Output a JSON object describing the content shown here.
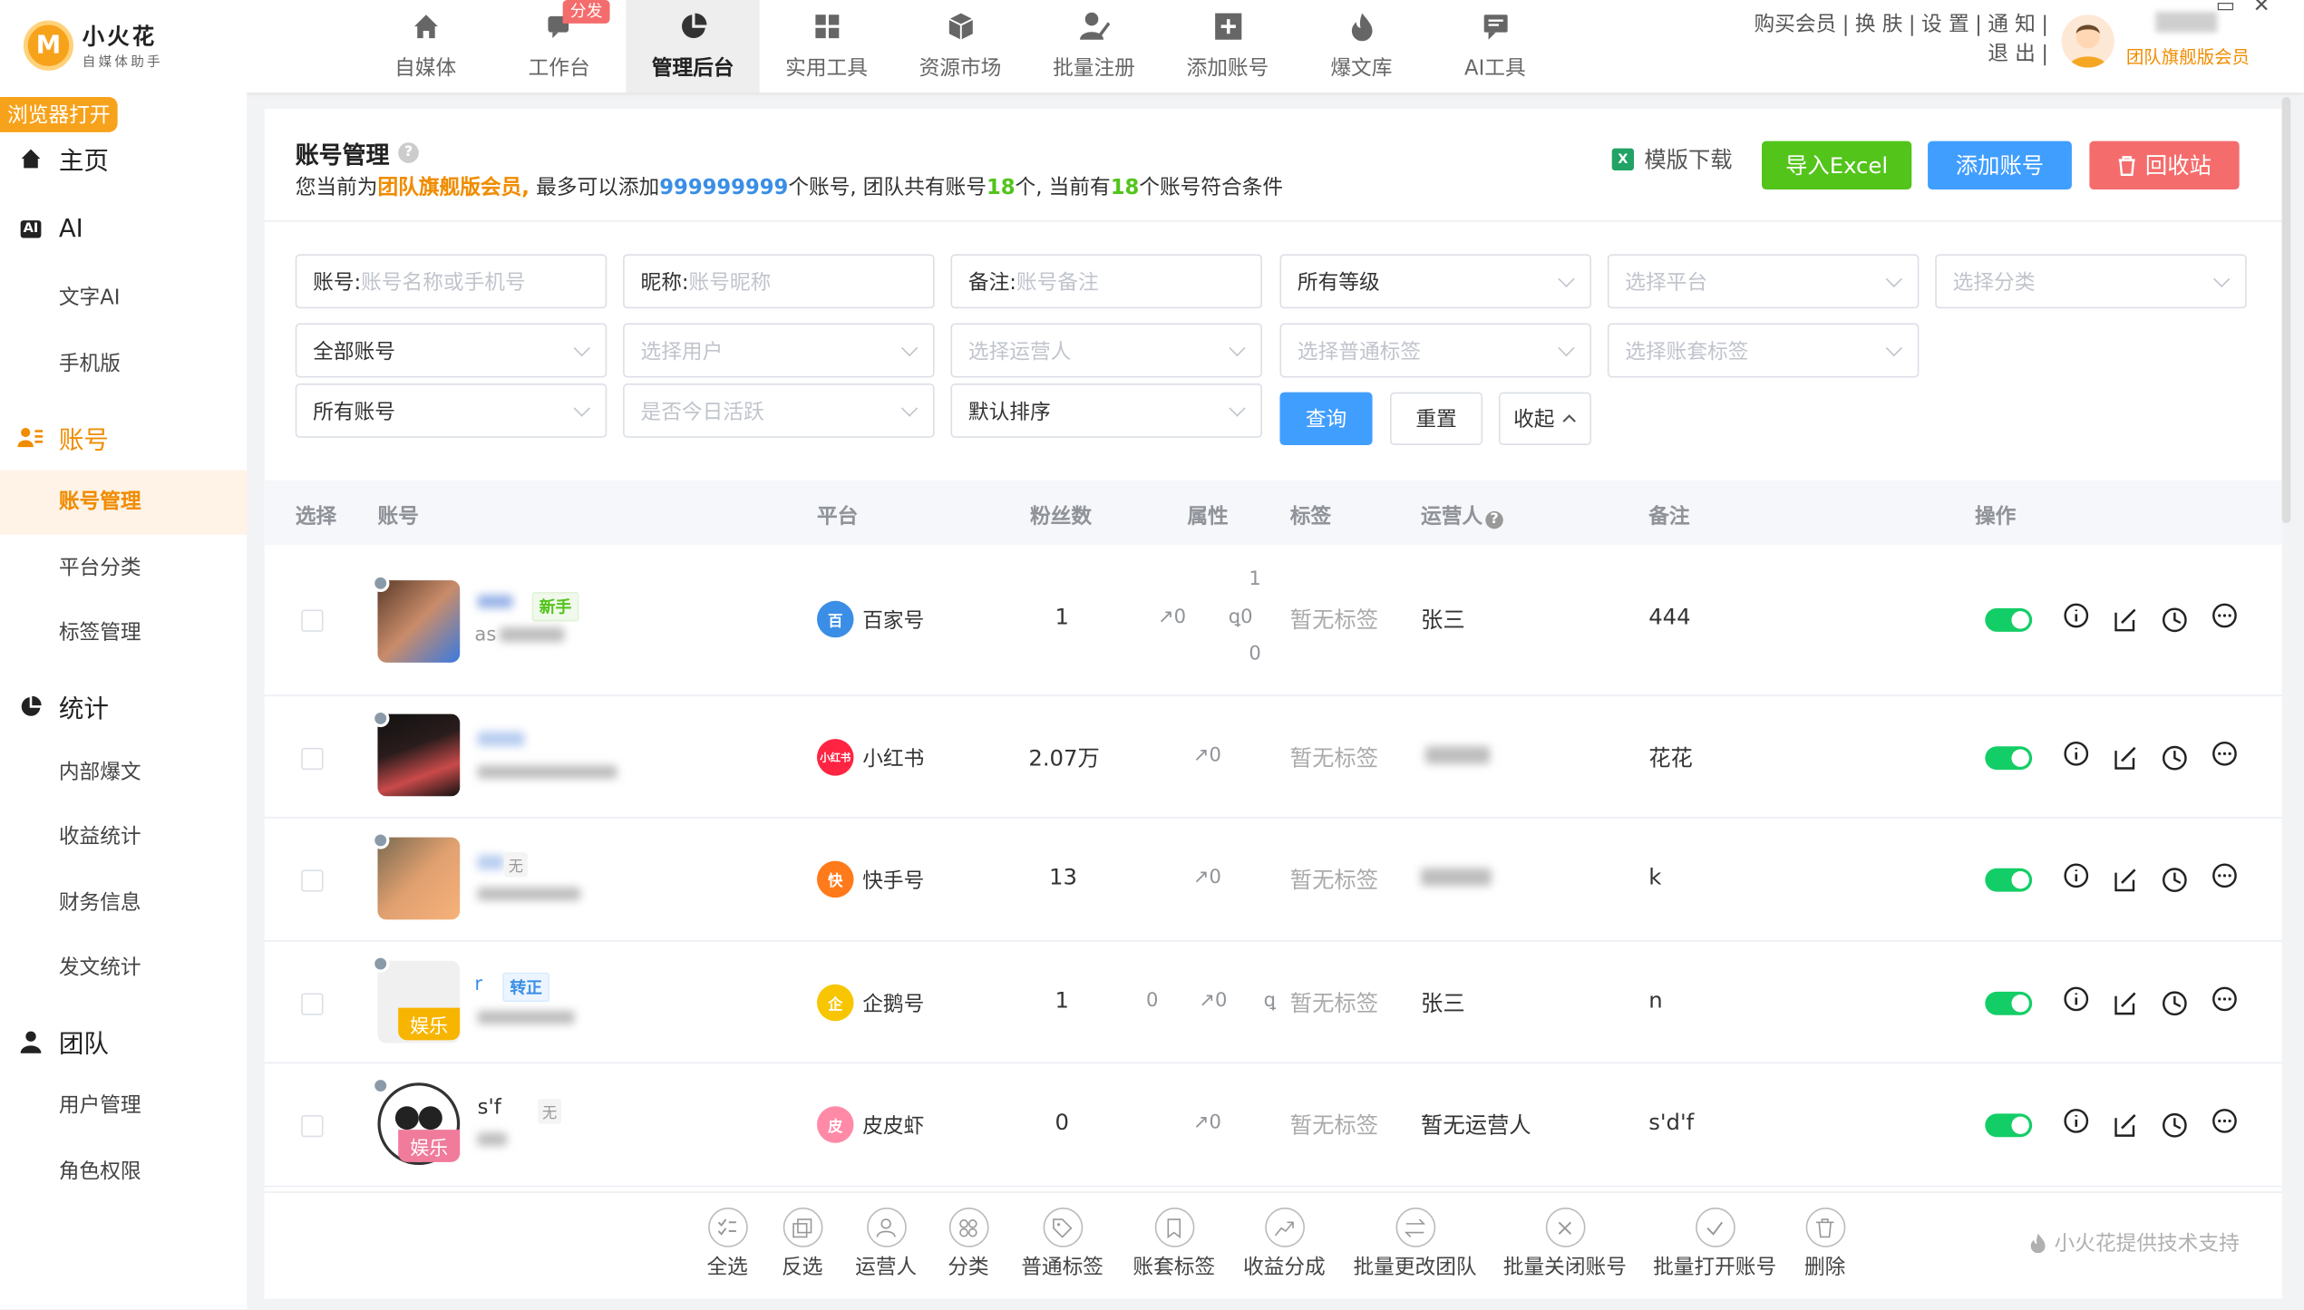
{
  "app": {
    "logo_letter": "M",
    "name": "小火花",
    "subtitle": "自媒体助手",
    "browser_tag": "浏览器打开"
  },
  "nav": [
    {
      "label": "自媒体",
      "icon": "home-icon"
    },
    {
      "label": "工作台",
      "icon": "chat-icon",
      "badge": "分发"
    },
    {
      "label": "管理后台",
      "icon": "pie-chart-icon",
      "active": true
    },
    {
      "label": "实用工具",
      "icon": "grid-icon"
    },
    {
      "label": "资源市场",
      "icon": "cube-icon"
    },
    {
      "label": "批量注册",
      "icon": "user-edit-icon"
    },
    {
      "label": "添加账号",
      "icon": "plus-square-icon"
    },
    {
      "label": "爆文库",
      "icon": "fire-icon"
    },
    {
      "label": "AI工具",
      "icon": "message-icon"
    }
  ],
  "toplinks": {
    "buy": "购买会员",
    "skin": "换 肤",
    "settings": "设 置",
    "notify": "通 知",
    "logout": "退 出",
    "sep": "|"
  },
  "member_label": "团队旗舰版会员",
  "sidebar": {
    "home": "主页",
    "ai": "AI",
    "ai_badge": "AI",
    "text_ai": "文字AI",
    "mobile": "手机版",
    "account": "账号",
    "account_manage": "账号管理",
    "platform_cat": "平台分类",
    "tag_manage": "标签管理",
    "stats": "统计",
    "internal": "内部爆文",
    "income": "收益统计",
    "finance": "财务信息",
    "post_stats": "发文统计",
    "team": "团队",
    "user_manage": "用户管理",
    "role": "角色权限"
  },
  "page": {
    "title": "账号管理",
    "help": "?",
    "info_pre": "您当前为",
    "info_level": "团队旗舰版会员,",
    "info_mid1": " 最多可以添加",
    "info_max": "999999999",
    "info_mid2": "个账号, 团队共有账号",
    "info_total": "18",
    "info_mid3": "个, 当前有",
    "info_match": "18",
    "info_post": "个账号符合条件",
    "download": "模版下载",
    "xls_icon": "X",
    "import": "导入Excel",
    "add": "添加账号",
    "recycle": "回收站",
    "colors": {
      "green": "#52c41a",
      "blue": "#409eff",
      "red": "#f56c6c",
      "orange": "#f08c00"
    }
  },
  "filters": {
    "account_label": "账号: ",
    "account_ph": "账号名称或手机号",
    "nick_label": "昵称: ",
    "nick_ph": "账号昵称",
    "note_label": "备注: ",
    "note_ph": "账号备注",
    "level": "所有等级",
    "platform": "选择平台",
    "category": "选择分类",
    "all_acc": "全部账号",
    "user": "选择用户",
    "operator": "选择运营人",
    "normal_tag": "选择普通标签",
    "set_tag": "选择账套标签",
    "all2": "所有账号",
    "active_today": "是否今日活跃",
    "sort": "默认排序",
    "query": "查询",
    "reset": "重置",
    "collapse": "收起"
  },
  "table": {
    "headers": {
      "select": "选择",
      "account": "账号",
      "platform": "平台",
      "fans": "粉丝数",
      "attr": "属性",
      "tag": "标签",
      "operator": "运营人",
      "note": "备注",
      "ops": "操作"
    },
    "rows": [
      {
        "platform": "百家号",
        "pcolor": "#3a8ee6",
        "pglyph": "百",
        "fans": "1",
        "a1": "0",
        "a2": "0",
        "a_top": "1",
        "a_bot": "0",
        "tag": "暂无标签",
        "operator": "张三",
        "note": "444",
        "badge": "新手",
        "name_visible": "as"
      },
      {
        "platform": "小红书",
        "pcolor": "#ff2442",
        "pglyph": "小红书",
        "fans": "2.07万",
        "a1": "0",
        "tag": "暂无标签",
        "operator": "",
        "note": "花花"
      },
      {
        "platform": "快手号",
        "pcolor": "#ff7a1a",
        "pglyph": "快",
        "fans": "13",
        "a1": "0",
        "tag": "暂无标签",
        "operator": "",
        "note": "k",
        "badge": "无"
      },
      {
        "platform": "企鹅号",
        "pcolor": "#f7c600",
        "pglyph": "企",
        "fans": "1",
        "a0": "0",
        "a1": "0",
        "tag": "暂无标签",
        "operator": "张三",
        "note": "n",
        "badge": "转正",
        "category": "娱乐",
        "name_visible": "r"
      },
      {
        "platform": "皮皮虾",
        "pcolor": "#ff8aa8",
        "pglyph": "皮",
        "fans": "0",
        "a1": "0",
        "tag": "暂无标签",
        "operator": "暂无运营人",
        "note": "s'd'f",
        "badge": "无",
        "category": "娱乐",
        "name_visible": "s'f"
      }
    ]
  },
  "bottom": {
    "all": "全选",
    "invert": "反选",
    "operator": "运营人",
    "category": "分类",
    "normal_tag": "普通标签",
    "set_tag": "账套标签",
    "income_share": "收益分成",
    "change_team": "批量更改团队",
    "close": "批量关闭账号",
    "open": "批量打开账号",
    "delete": "删除",
    "support": "小火花提供技术支持"
  }
}
